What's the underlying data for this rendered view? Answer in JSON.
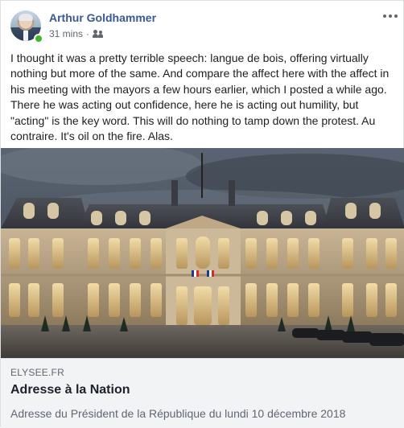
{
  "post": {
    "author": "Arthur Goldhammer",
    "time": "31 mins",
    "separator": "·",
    "audience_icon": "friends-icon",
    "more_icon": "more-horizontal-icon",
    "text": "I thought it was a pretty terrible speech: langue de bois, offering virtually nothing but more of the same. And compare the affect here with the affect in his meeting with the mayors a few hours earlier, which I posted a while ago. There he was acting out confidence, here he is acting out humility, but \"acting\" is the key word. This will do nothing to tamp down the protest. Au contraire. It's oil on the fire. Alas."
  },
  "link": {
    "domain": "ELYSEE.FR",
    "title": "Adresse à la Nation",
    "description": "Adresse du Président de la République du lundi 10 décembre 2018"
  },
  "colors": {
    "author": "#385898",
    "online": "#42b72a",
    "link_panel": "#f2f3f5",
    "secondary_text": "#606770"
  }
}
